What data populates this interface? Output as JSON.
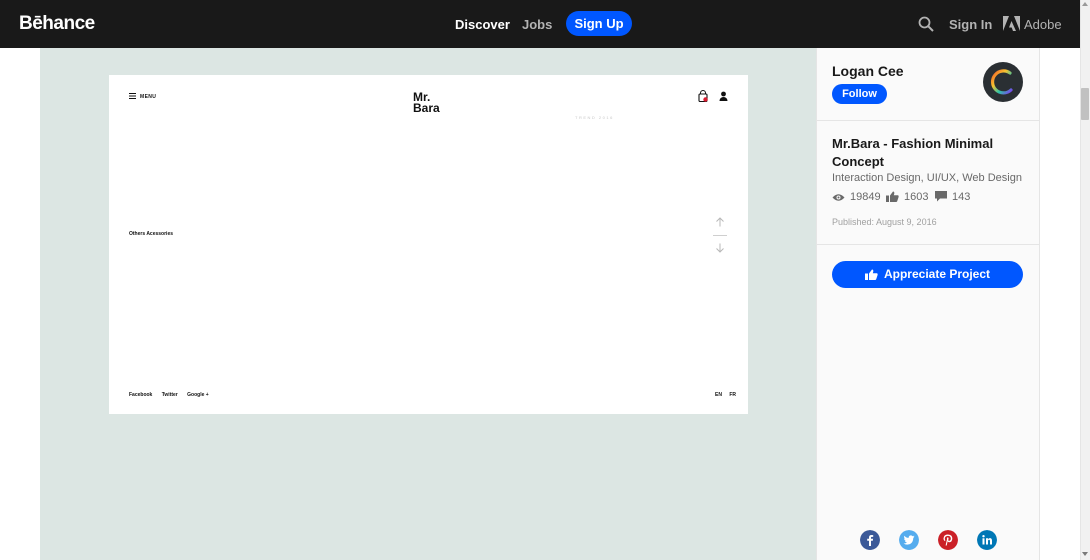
{
  "header": {
    "logo": "Bēhance",
    "nav": [
      "Discover",
      "Jobs"
    ],
    "signup_label": "Sign Up",
    "signin_label": "Sign In",
    "adobe_label": "Adobe"
  },
  "artboard": {
    "menu_label": "MENU",
    "brand_line1": "Mr.",
    "brand_line2": "Bara",
    "faded_text": "TREND 2016",
    "section_label": "Others Acessories",
    "social_links": [
      "Facebook",
      "Twitter",
      "Google +"
    ],
    "languages": [
      "EN",
      "FR"
    ]
  },
  "sidebar": {
    "owner_name": "Logan Cee",
    "follow_label": "Follow",
    "project_title": "Mr.Bara - Fashion Minimal Concept",
    "project_fields": "Interaction Design, UI/UX, Web Design",
    "stats": {
      "views": "19849",
      "appreciations": "1603",
      "comments": "143"
    },
    "published": "Published: August 9, 2016",
    "appreciate_label": "Appreciate Project"
  },
  "colors": {
    "accent": "#0057ff",
    "topbar": "#191919",
    "canvas_bg": "#dce6e3",
    "facebook": "#3b5998",
    "twitter": "#55acee",
    "pinterest": "#cb2027",
    "linkedin": "#0077b5"
  },
  "icons": {
    "search": "search-icon",
    "adobe": "adobe-icon",
    "menu": "menu-icon",
    "bag": "shopping-bag-icon",
    "user": "user-icon",
    "views": "eye-icon",
    "appreciations": "thumbs-up-icon",
    "comments": "comment-icon"
  }
}
